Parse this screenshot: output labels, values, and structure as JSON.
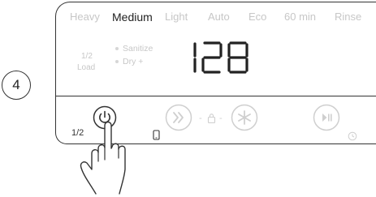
{
  "step": {
    "number": "4"
  },
  "programs": [
    {
      "label": "Heavy",
      "active": false
    },
    {
      "label": "Medium",
      "active": true
    },
    {
      "label": "Light",
      "active": false
    },
    {
      "label": "Auto",
      "active": false
    },
    {
      "label": "Eco",
      "active": false
    },
    {
      "label": "60 min",
      "active": false
    },
    {
      "label": "Rinse",
      "active": false
    }
  ],
  "half_load": {
    "line1": "1/2",
    "line2": "Load"
  },
  "options": [
    {
      "label": "Sanitize"
    },
    {
      "label": "Dry +"
    }
  ],
  "display": {
    "value": "128"
  },
  "controls": {
    "half_label": "1/2",
    "separator_left": "-",
    "separator_right": "-"
  },
  "colors": {
    "outline": "#333333",
    "faint": "#c7c7c7",
    "active": "#222222"
  },
  "icons": [
    "power-icon",
    "fast-forward-icon",
    "lock-icon",
    "star-icon",
    "play-pause-icon",
    "clock-icon",
    "phone-icon",
    "hand-pointer-icon"
  ]
}
